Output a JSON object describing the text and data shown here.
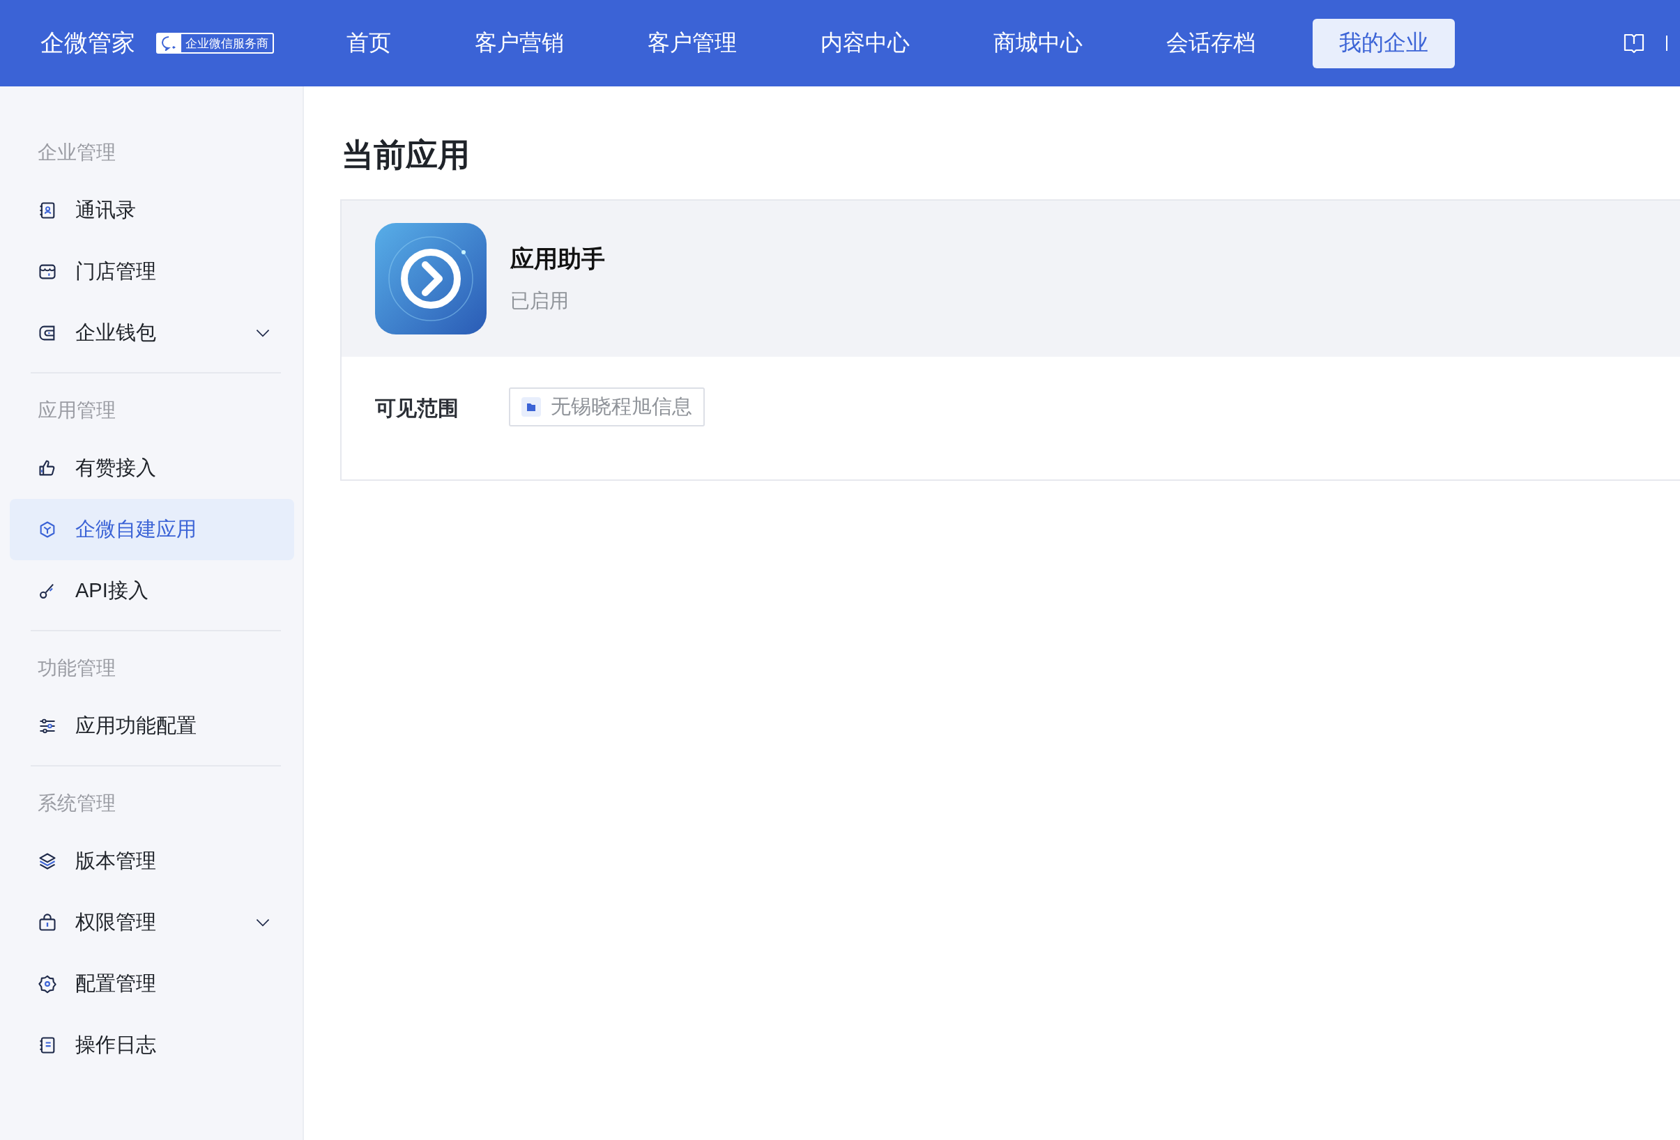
{
  "header": {
    "brand": "企微管家",
    "badge": "企业微信服务商",
    "nav": [
      {
        "label": "首页",
        "selected": false
      },
      {
        "label": "客户营销",
        "selected": false
      },
      {
        "label": "客户管理",
        "selected": false
      },
      {
        "label": "内容中心",
        "selected": false
      },
      {
        "label": "商城中心",
        "selected": false
      },
      {
        "label": "会话存档",
        "selected": false
      },
      {
        "label": "我的企业",
        "selected": true
      }
    ]
  },
  "sidebar": {
    "groups": [
      {
        "title": "企业管理",
        "items": [
          {
            "label": "通讯录",
            "kind": "page",
            "selected": false
          },
          {
            "label": "门店管理",
            "kind": "page",
            "selected": false
          },
          {
            "label": "企业钱包",
            "kind": "group",
            "selected": false
          }
        ]
      },
      {
        "title": "应用管理",
        "items": [
          {
            "label": "有赞接入",
            "kind": "page",
            "selected": false
          },
          {
            "label": "企微自建应用",
            "kind": "page",
            "selected": true
          },
          {
            "label": "API接入",
            "kind": "page",
            "selected": false
          }
        ]
      },
      {
        "title": "功能管理",
        "items": [
          {
            "label": "应用功能配置",
            "kind": "page",
            "selected": false
          }
        ]
      },
      {
        "title": "系统管理",
        "items": [
          {
            "label": "版本管理",
            "kind": "page",
            "selected": false
          },
          {
            "label": "权限管理",
            "kind": "group",
            "selected": false
          },
          {
            "label": "配置管理",
            "kind": "page",
            "selected": false
          },
          {
            "label": "操作日志",
            "kind": "page",
            "selected": false
          }
        ]
      }
    ]
  },
  "page": {
    "title": "当前应用",
    "app": {
      "name": "应用助手",
      "status": "已启用"
    },
    "visibility": {
      "label": "可见范围",
      "tags": [
        "无锡晓程旭信息"
      ]
    }
  }
}
